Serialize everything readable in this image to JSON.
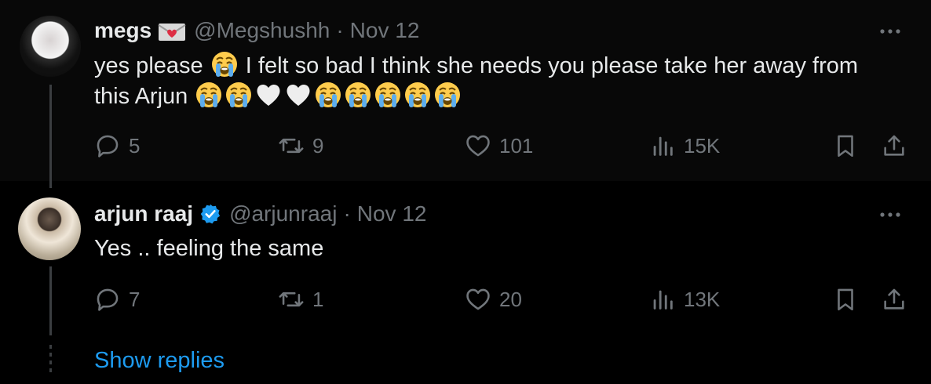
{
  "tweets": [
    {
      "name": "megs",
      "name_icon": "envelope-heart-icon",
      "handle": "@Megshushh",
      "separator": "·",
      "date": "Nov 12",
      "text_line1_prefix": "yes please",
      "text_line1_suffix": "I felt so bad I think she needs you please take her away from",
      "text_line2_prefix": "this Arjun",
      "emojis": [
        "loudly-crying-face",
        "white-heart"
      ],
      "stats": {
        "replies": "5",
        "reposts": "9",
        "likes": "101",
        "views": "15K"
      }
    },
    {
      "name": "arjun raaj",
      "name_icon": "verified-badge-icon",
      "handle": "@arjunraaj",
      "separator": "·",
      "date": "Nov 12",
      "text": "Yes .. feeling the same",
      "stats": {
        "replies": "7",
        "reposts": "1",
        "likes": "20",
        "views": "13K"
      }
    }
  ],
  "show_replies": "Show replies",
  "colors": {
    "background": "#000000",
    "highlighted_background": "#080808",
    "text_primary": "#e7e9ea",
    "text_secondary": "#71767b",
    "link_blue": "#1d9bf0",
    "verified_blue": "#1d9bf0",
    "thread_line": "#3a3d40"
  }
}
